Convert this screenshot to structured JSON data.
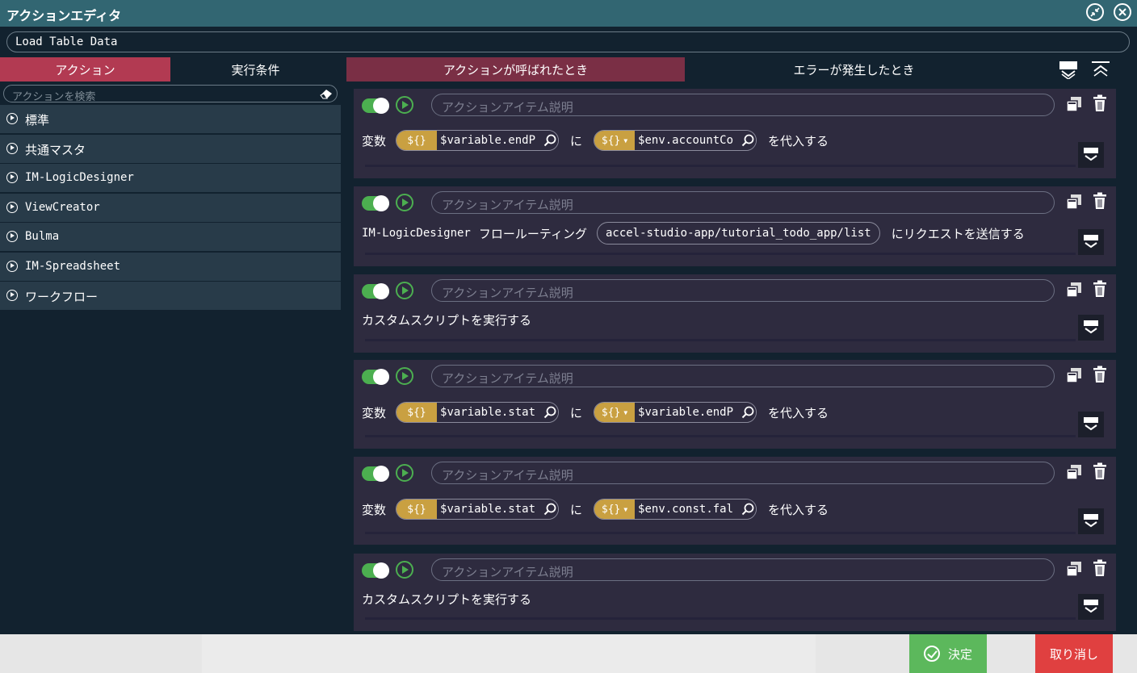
{
  "window": {
    "title": "アクションエディタ",
    "action_name": "Load Table Data"
  },
  "left_tabs": [
    {
      "label": "アクション",
      "active": true
    },
    {
      "label": "実行条件",
      "active": false
    }
  ],
  "search": {
    "placeholder": "アクションを検索"
  },
  "categories": [
    {
      "label": "標準"
    },
    {
      "label": "共通マスタ"
    },
    {
      "label": "IM-LogicDesigner"
    },
    {
      "label": "ViewCreator"
    },
    {
      "label": "Bulma"
    },
    {
      "label": "IM-Spreadsheet"
    },
    {
      "label": "ワークフロー"
    }
  ],
  "right_tabs": [
    {
      "label": "アクションが呼ばれたとき",
      "active": true
    },
    {
      "label": "エラーが発生したとき",
      "active": false
    }
  ],
  "desc_placeholder": "アクションアイテム説明",
  "badge": "${}",
  "items": [
    {
      "type": "assign",
      "prefix": "変数",
      "var": "$variable.endP",
      "mid": "に",
      "value": "$env.accountCo",
      "suffix": "を代入する"
    },
    {
      "type": "logic",
      "prefix": "IM-LogicDesigner",
      "prefix2": "フロールーティング",
      "url": "accel-studio-app/tutorial_todo_app/list",
      "suffix": "にリクエストを送信する"
    },
    {
      "type": "script",
      "text": "カスタムスクリプトを実行する"
    },
    {
      "type": "assign",
      "prefix": "変数",
      "var": "$variable.stat",
      "mid": "に",
      "value": "$variable.endP",
      "suffix": "を代入する"
    },
    {
      "type": "assign",
      "prefix": "変数",
      "var": "$variable.stat",
      "mid": "に",
      "value": "$env.const.fal",
      "suffix": "を代入する"
    },
    {
      "type": "script",
      "text": "カスタムスクリプトを実行する"
    }
  ],
  "footer": {
    "ok_label": "決定",
    "cancel_label": "取り消し"
  },
  "colors": {
    "titlebar": "#326672",
    "active_left_tab": "#b23a52",
    "active_right_tab": "#7a2f45",
    "toggle_on": "#4caf50",
    "badge": "#c9a041",
    "ok": "#5cb85c",
    "cancel": "#e04040"
  }
}
